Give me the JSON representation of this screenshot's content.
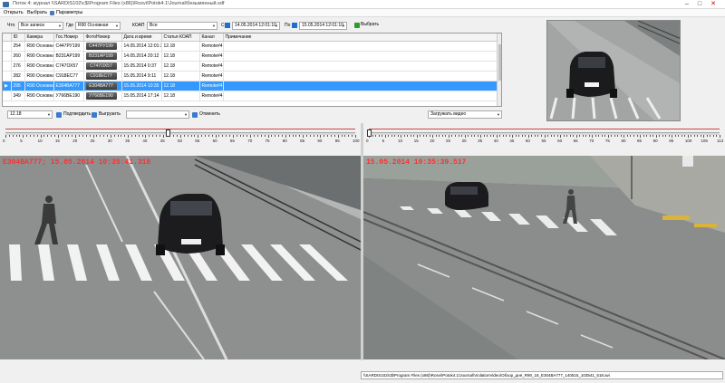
{
  "window": {
    "title": "Поток 4: журнал \\\\SARDIS102\\c$\\Program Files (x86)\\Rosvi\\Potok4.1\\Journal\\безымянный.sdf",
    "min": "–",
    "max": "□",
    "close": "✕"
  },
  "menu": {
    "open": "Открыть",
    "select": "Выбрать",
    "params": "Параметры"
  },
  "filters": {
    "what_label": "Что",
    "what_value": "Все записи",
    "where_label": "Где",
    "where_value": "R90 Основная",
    "koap_label": "КОАП",
    "koap_value": "Все",
    "from_label": "С",
    "from_value": "14.05.2014 12:01:10",
    "to_label": "По",
    "to_value": "15.05.2014 12:01:10",
    "select_button": "Выбрать"
  },
  "table": {
    "columns": [
      "",
      "ID",
      "Камера",
      "Гос.Номер",
      "ФотоНомер",
      "Дата и время",
      "Статья КОАП",
      "Канал",
      "Примечание"
    ],
    "rows": [
      {
        "marker": "",
        "id": "254",
        "camera": "R90 Основная",
        "plate": "С447РУ199",
        "photo": "С447РУ199",
        "datetime": "14.05.2014 12:01:33",
        "koap": "12.18",
        "channel": "Remote#4",
        "note": ""
      },
      {
        "marker": "",
        "id": "260",
        "camera": "R90 Основная",
        "plate": "В231АР199",
        "photo": "В231АР199",
        "datetime": "14.05.2014 20:12",
        "koap": "12.18",
        "channel": "Remote#4",
        "note": ""
      },
      {
        "marker": "",
        "id": "276",
        "camera": "R90 Основная",
        "plate": "С747ОХ57",
        "photo": "С747ОХ57",
        "datetime": "15.05.2014 0:37",
        "koap": "12.18",
        "channel": "Remote#4",
        "note": ""
      },
      {
        "marker": "",
        "id": "282",
        "camera": "R90 Основная",
        "plate": "С918ЕС77",
        "photo": "С918ЕС77",
        "datetime": "15.05.2014 9:11",
        "koap": "12.18",
        "channel": "Remote#4",
        "note": ""
      },
      {
        "marker": "▶",
        "id": "295",
        "camera": "R90 Основная",
        "plate": "Е304ВА777",
        "photo": "Е304ВА777",
        "datetime": "15.05.2014 10:35",
        "koap": "12.18",
        "channel": "Remote#4",
        "note": "",
        "selected": true
      },
      {
        "marker": "",
        "id": "349",
        "camera": "R90 Основная",
        "plate": "У766ВЕ190",
        "photo": "У766ВЕ190",
        "datetime": "15.05.2014 17:14",
        "koap": "12.18",
        "channel": "Remote#4",
        "note": ""
      }
    ]
  },
  "toolbar": {
    "koap_select": "12.18",
    "confirm_label": "Подтвердить",
    "upload_label": "Выгрузить",
    "empty_select": "",
    "cancel_label": "Отменить",
    "load_video": "Загружать видео"
  },
  "slider_left": {
    "ticks": [
      "0",
      "5",
      "10",
      "15",
      "20",
      "25",
      "30",
      "35",
      "40",
      "45",
      "50",
      "55",
      "60",
      "65",
      "70",
      "75",
      "80",
      "85",
      "90",
      "95",
      "100"
    ],
    "position": 0.465
  },
  "slider_right": {
    "ticks": [
      "0",
      "5",
      "10",
      "15",
      "20",
      "25",
      "30",
      "35",
      "40",
      "45",
      "50",
      "55",
      "60",
      "65",
      "70",
      "75",
      "80",
      "85",
      "90",
      "95",
      "100",
      "105",
      "113"
    ],
    "position": 0.0
  },
  "video_left": {
    "overlay": "Е304ВА777; 15.05.2014 10:35:41.318"
  },
  "video_right": {
    "overlay": "15.05.2014 10:35:39.517"
  },
  "statusbar": {
    "path": "\\\\SARDIS102\\c$\\Program Files (x86)\\Rosvi\\Potok4.1\\Journal\\ViolationVideo\\Обзор_дня_R90_18_Е304ВА777_140515_103541_518.avi"
  },
  "colors": {
    "selection": "#3399ff",
    "overlay_text": "#ff3030",
    "slider_line": "#c84848"
  }
}
